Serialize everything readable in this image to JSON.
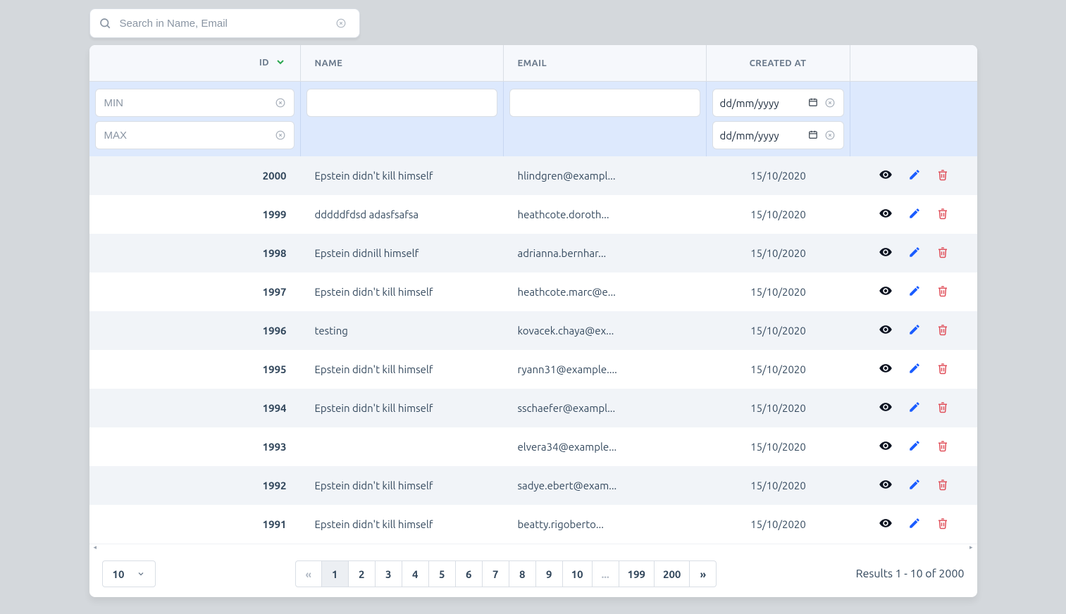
{
  "search": {
    "placeholder": "Search in Name, Email",
    "value": ""
  },
  "columns": {
    "id": "ID",
    "name": "NAME",
    "email": "EMAIL",
    "created": "CREATED AT"
  },
  "filters": {
    "id_min_placeholder": "MIN",
    "id_max_placeholder": "MAX",
    "date_placeholder": "dd/mm/yyyy"
  },
  "rows": [
    {
      "id": "2000",
      "name": "Epstein didn't kill himself",
      "email": "hlindgren@exampl...",
      "created": "15/10/2020"
    },
    {
      "id": "1999",
      "name": "dddddfdsd adasfsafsa",
      "email": "heathcote.doroth...",
      "created": "15/10/2020"
    },
    {
      "id": "1998",
      "name": "Epstein didnill himself",
      "email": "adrianna.bernhar...",
      "created": "15/10/2020"
    },
    {
      "id": "1997",
      "name": "Epstein didn't kill himself",
      "email": "heathcote.marc@e...",
      "created": "15/10/2020"
    },
    {
      "id": "1996",
      "name": "testing",
      "email": "kovacek.chaya@ex...",
      "created": "15/10/2020"
    },
    {
      "id": "1995",
      "name": "Epstein didn't kill himself",
      "email": "ryann31@example....",
      "created": "15/10/2020"
    },
    {
      "id": "1994",
      "name": "Epstein didn't kill himself",
      "email": "sschaefer@exampl...",
      "created": "15/10/2020"
    },
    {
      "id": "1993",
      "name": "",
      "email": "elvera34@example...",
      "created": "15/10/2020"
    },
    {
      "id": "1992",
      "name": "Epstein didn't kill himself",
      "email": "sadye.ebert@exam...",
      "created": "15/10/2020"
    },
    {
      "id": "1991",
      "name": "Epstein didn't kill himself",
      "email": "beatty.rigoberto...",
      "created": "15/10/2020"
    }
  ],
  "pager": {
    "first": "«",
    "last": "»",
    "ellipsis": "...",
    "pages": [
      "1",
      "2",
      "3",
      "4",
      "5",
      "6",
      "7",
      "8",
      "9",
      "10"
    ],
    "tail": [
      "199",
      "200"
    ],
    "active_index": 0
  },
  "page_size": {
    "value": "10"
  },
  "results_text": "Results 1 - 10 of 2000"
}
